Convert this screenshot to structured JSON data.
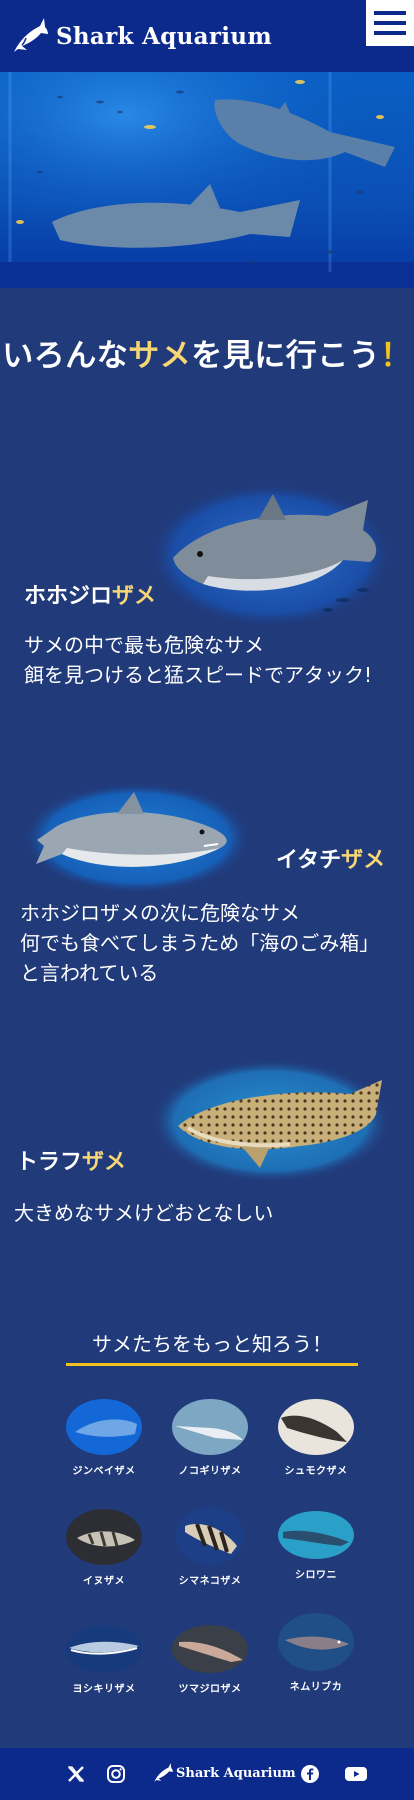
{
  "header": {
    "logo_text": "Shark Aquarium",
    "menu_icon": "hamburger-menu-icon"
  },
  "hero": {
    "image": "whale-shark-aquarium-tank-photo"
  },
  "heading": {
    "part1": "いろんな",
    "part2": "サメ",
    "part3": "を見に行こう",
    "part4": "！"
  },
  "sharks": [
    {
      "name_a": "ホホジロ",
      "name_b": "ザメ",
      "desc_lines": [
        "サメの中で最も危険なサメ",
        "餌を見つけると猛スピードでアタック!"
      ],
      "image": "great-white-shark-photo"
    },
    {
      "name_a": "イタチ",
      "name_b": "ザメ",
      "desc_lines": [
        "ホホジロザメの次に危険なサメ",
        "何でも食べてしまうため「海のごみ箱」",
        "と言われている"
      ],
      "image": "tiger-shark-photo"
    },
    {
      "name_a": "トラフ",
      "name_b": "ザメ",
      "desc_lines": [
        "大きめなサメけどおとなしい"
      ],
      "image": "zebra-shark-photo"
    }
  ],
  "know_more": {
    "title": "サメたちをもっと知ろう！",
    "items": [
      {
        "label": "ジンベイザメ"
      },
      {
        "label": "ノコギリザメ"
      },
      {
        "label": "シュモクザメ"
      },
      {
        "label": "イヌザメ"
      },
      {
        "label": "シマネコザメ"
      },
      {
        "label": "シロワニ"
      },
      {
        "label": "ヨシキリザメ"
      },
      {
        "label": "ツマジロザメ"
      },
      {
        "label": "ネムリブカ"
      }
    ]
  },
  "footer": {
    "logo_text": "Shark Aquarium",
    "icons": [
      "x-icon",
      "instagram-icon",
      "facebook-icon",
      "youtube-icon"
    ]
  },
  "colors": {
    "header": "#0c2a8c",
    "background": "#213a7a",
    "accent": "#f6d774"
  }
}
